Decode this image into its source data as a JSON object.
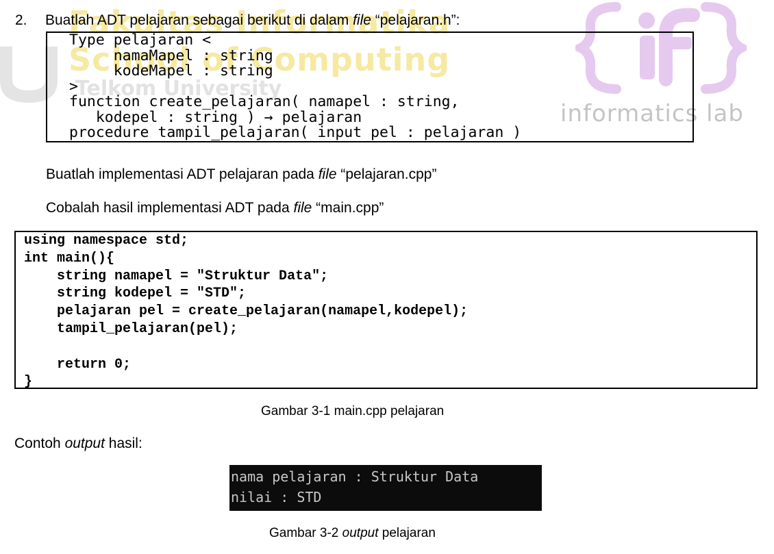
{
  "watermark": {
    "line1": "Fakultas Informatika",
    "line2": "School of Computing",
    "line3": "Telkom University",
    "logo_text": "informatics lab"
  },
  "heading": {
    "number": "2.",
    "text_before": "Buatlah ADT pelajaran sebagai berikut di dalam ",
    "file_word": "file",
    "text_after": " “pelajaran.h”:"
  },
  "adt_code": "Type pelajaran <\n     namaMapel : string\n     kodeMapel : string\n>\nfunction create_pelajaran( namapel : string,\n   kodepel : string ) → pelajaran\nprocedure tampil_pelajaran( input pel : pelajaran )",
  "impl_para": {
    "before": "Buatlah implementasi ADT pelajaran pada ",
    "file_word": "file",
    "after": " “pelajaran.cpp”"
  },
  "try_para": {
    "before": "Cobalah hasil implementasi ADT pada ",
    "file_word": "file",
    "after": " “main.cpp”"
  },
  "main_code": "using namespace std;\nint main(){\n    string namapel = \"Struktur Data\";\n    string kodepel = \"STD\";\n    pelajaran pel = create_pelajaran(namapel,kodepel);\n    tampil_pelajaran(pel);\n\n    return 0;\n}",
  "caption1": "Gambar 3-1 main.cpp pelajaran",
  "output_label": {
    "before": "Contoh ",
    "italic": "output",
    "after": " hasil:"
  },
  "console_output": "nama pelajaran : Struktur Data\nnilai : STD",
  "caption2": {
    "before": "Gambar 3-2 ",
    "italic": "output",
    "after": " pelajaran"
  },
  "colors": {
    "watermark_yellow": "#f6e9a2",
    "watermark_gray": "#e2e2e2",
    "logo_purple": "#d9b4e6",
    "console_bg": "#0c0c0c",
    "console_text": "#c8c8c8"
  }
}
